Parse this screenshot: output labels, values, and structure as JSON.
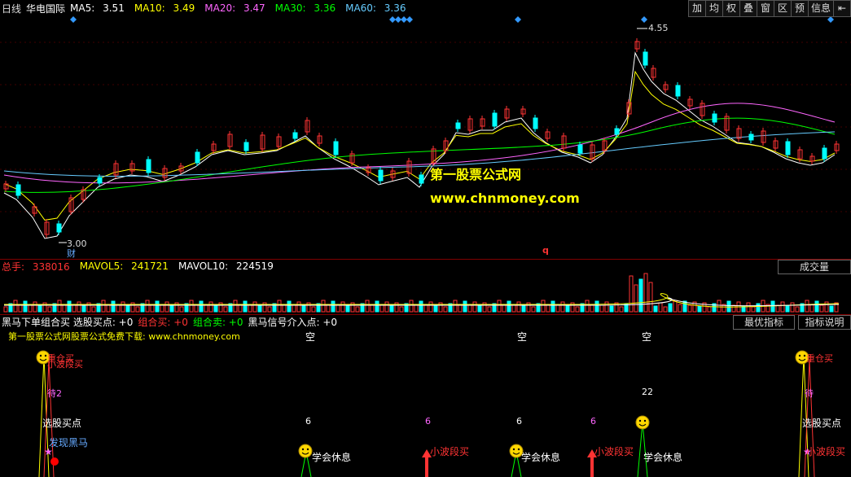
{
  "main": {
    "period": "日线",
    "stock": "华电国际",
    "ma": [
      {
        "label": "MA5:",
        "value": "3.51",
        "color": "#ffffff"
      },
      {
        "label": "MA10:",
        "value": "3.49",
        "color": "#ffff00"
      },
      {
        "label": "MA20:",
        "value": "3.47",
        "color": "#ff66ff"
      },
      {
        "label": "MA30:",
        "value": "3.36",
        "color": "#00ff00"
      },
      {
        "label": "MA60:",
        "value": "3.36",
        "color": "#66ccff"
      }
    ],
    "high_label": "4.55",
    "low_label": "3.00",
    "cai_marker": "财",
    "q_marker": "q"
  },
  "toolbar": [
    "加",
    "均",
    "权",
    "叠",
    "窗",
    "区",
    "预",
    "信息",
    "⇤"
  ],
  "watermark": {
    "name": "第一股票公式网",
    "url": "www.chnmoney.com"
  },
  "volume": {
    "total_label": "总手:",
    "total": "338016",
    "mavol5_label": "MAVOL5:",
    "mavol5": "241721",
    "mavol10_label": "MAVOL10:",
    "mavol10": "224519",
    "button": "成交量"
  },
  "indicator": {
    "line1": "黑马下单组合买 选股买点: +0",
    "combo_buy": "组合买: +0",
    "combo_sell": "组合卖: +0",
    "signal": "黑马信号介入点: +0",
    "promo": "第一股票公式网股票公式免费下载: www.chnmoney.com",
    "btn_best": "最优指标",
    "btn_help": "指标说明",
    "kong": "空",
    "labels": {
      "heavy_buy": "重仓买",
      "small_buy": "小波段买",
      "wait2": "待2",
      "pick": "选股买点",
      "found": "发现黑马",
      "rest": "学会休息",
      "six": "6",
      "twentytwo": "22",
      "wait": "待"
    }
  },
  "colors": {
    "up": "#ff3333",
    "down": "#00ffff",
    "bg": "#000000",
    "grid": "#800000"
  }
}
